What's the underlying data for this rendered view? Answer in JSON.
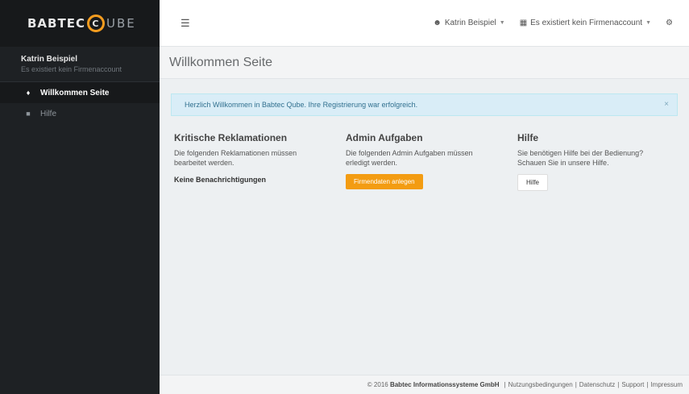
{
  "brand": {
    "prefix": "BABTEC",
    "c": "C",
    "suffix": "UBE",
    "accent": "#f49c1f"
  },
  "user": {
    "name": "Katrin Beispiel",
    "subtitle": "Es existiert kein Firmenaccount"
  },
  "sidebar": {
    "items": [
      {
        "label": "Willkommen Seite",
        "icon": "home-icon",
        "active": true
      },
      {
        "label": "Hilfe",
        "icon": "book-icon",
        "active": false
      }
    ]
  },
  "topbar": {
    "user_menu": "Katrin Beispiel",
    "account_menu": "Es existiert kein Firmenaccount"
  },
  "page": {
    "title": "Willkommen Seite"
  },
  "alert": {
    "text": "Herzlich Willkommen in Babtec Qube. Ihre Registrierung war erfolgreich.",
    "close": "×"
  },
  "columns": {
    "complaints": {
      "title": "Kritische Reklamationen",
      "text": "Die folgenden Reklamationen müssen bearbeitet werden.",
      "note": "Keine Benachrichtigungen"
    },
    "admin": {
      "title": "Admin Aufgaben",
      "text": "Die folgenden Admin Aufgaben müssen erledigt werden.",
      "button": "Firmendaten anlegen"
    },
    "help": {
      "title": "Hilfe",
      "text": "Sie benötigen Hilfe bei der Bedienung? Schauen Sie in unsere Hilfe.",
      "button": "Hilfe"
    }
  },
  "footer": {
    "copyright": "© 2016",
    "company": "Babtec Informationssysteme GmbH",
    "links": [
      "Nutzungsbedingungen",
      "Datenschutz",
      "Support",
      "Impressum"
    ]
  }
}
